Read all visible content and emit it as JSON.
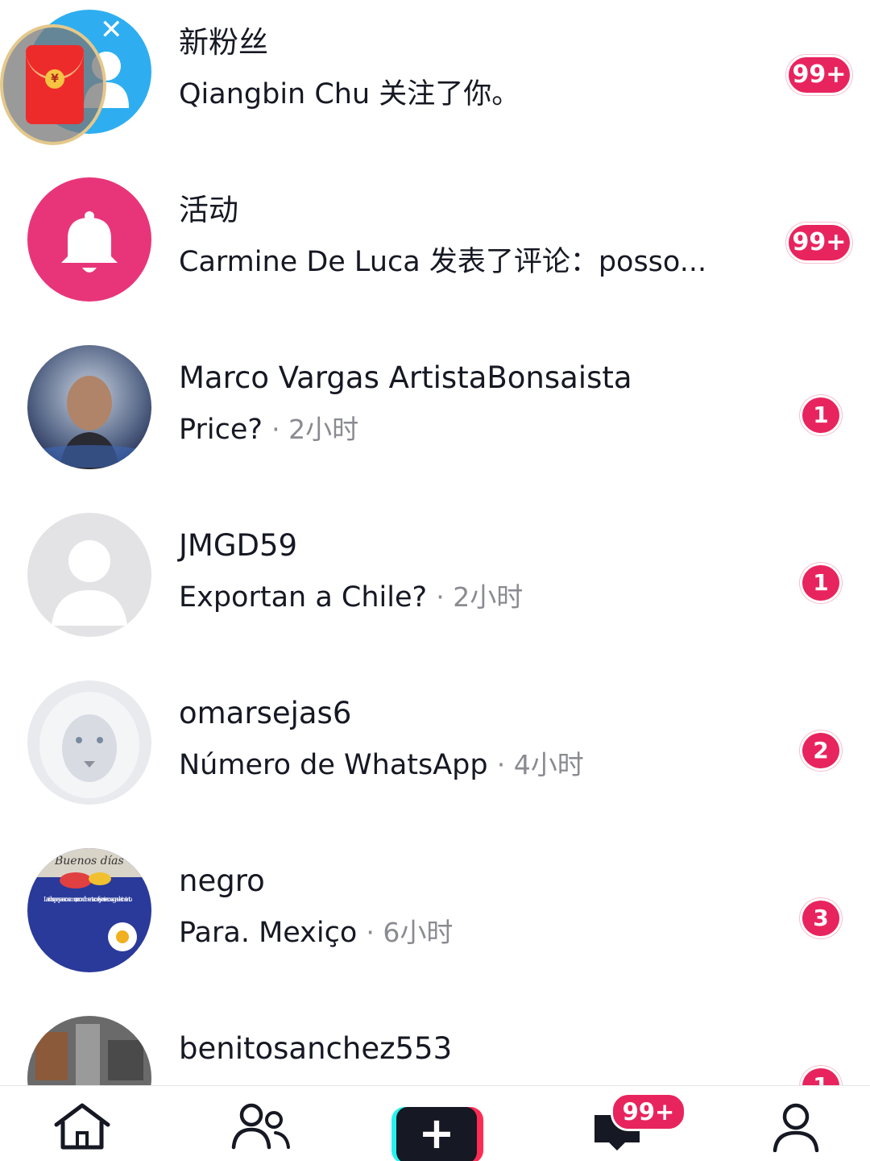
{
  "colors": {
    "accent": "#e8245e",
    "text": "#161823",
    "muted": "#8a8b91",
    "activity_avatar": "#e8357a",
    "followers_avatar": "#2eaef0"
  },
  "notifications": [
    {
      "title": "新粉丝",
      "text": "Qiangbin Chu 关注了你。",
      "time": "",
      "badge": "99+",
      "avatar_icon": "person-icon"
    },
    {
      "title": "活动",
      "text": "Carmine De Luca 发表了评论：posso...",
      "time": "",
      "badge": "99+",
      "avatar_icon": "bell-icon"
    }
  ],
  "messages": [
    {
      "name": "Marco Vargas ArtistaBonsaista",
      "text": "Price?",
      "time": "· 2小时",
      "badge": "1"
    },
    {
      "name": "JMGD59",
      "text": "Exportan a Chile?",
      "time": "· 2小时",
      "badge": "1"
    },
    {
      "name": "omarsejas6",
      "text": "Número de WhatsApp",
      "time": "· 4小时",
      "badge": "2"
    },
    {
      "name": "negro",
      "text": "Para. Mexiço",
      "time": "· 6小时",
      "badge": "3"
    },
    {
      "name": "benitosanchez553",
      "text": "",
      "time": "",
      "badge": "1"
    }
  ],
  "avatar_text": {
    "buenos": "Buenos días",
    "card_lines": "La vida se prepara con amor, se condimenta con fe, y se vive con agradecimiento."
  },
  "redpacket": {
    "coin": "¥",
    "close": "✕"
  },
  "tabbar": {
    "inbox_badge": "99+",
    "plus": "+",
    "tabs": [
      "home-icon",
      "friends-icon",
      "create-icon",
      "inbox-icon",
      "profile-icon"
    ]
  }
}
